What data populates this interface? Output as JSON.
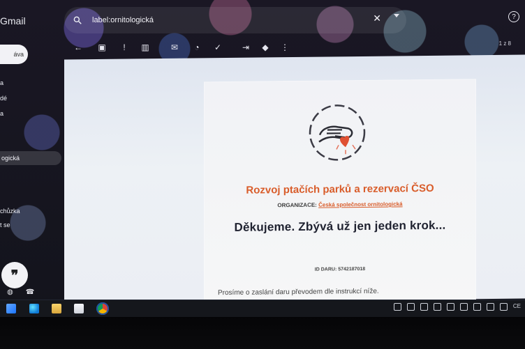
{
  "app": {
    "name": "Gmail"
  },
  "search": {
    "query": "label:ornitologická"
  },
  "header": {
    "help_icon": "help-icon",
    "clear_icon": "close-icon"
  },
  "toolbar": {
    "pager": "1 z 8",
    "icons": [
      "back-icon",
      "archive-icon",
      "report-spam-icon",
      "delete-icon",
      "mark-unread-icon",
      "snooze-icon",
      "add-task-icon",
      "move-to-icon",
      "label-icon",
      "more-options-icon"
    ]
  },
  "sidebar": {
    "compose": "áva",
    "items": [
      "a",
      "dé",
      "a",
      "ogická",
      "chůzka",
      "t se"
    ]
  },
  "email": {
    "title": "Rozvoj ptačích parků a rezervací ČSO",
    "organization_label": "ORGANIZACE:",
    "organization_name": "Česká společnost ornitologická",
    "headline": "Děkujeme. Zbývá už jen jeden krok...",
    "donation_id_label": "ID DARU:",
    "donation_id": "5742187018",
    "transfer_note": "Prosíme o zaslání daru převodem dle instrukcí níže."
  },
  "taskbar": {
    "tray_label": "CE"
  },
  "colors": {
    "accent": "#d95d2b",
    "headline": "#1f2230"
  }
}
